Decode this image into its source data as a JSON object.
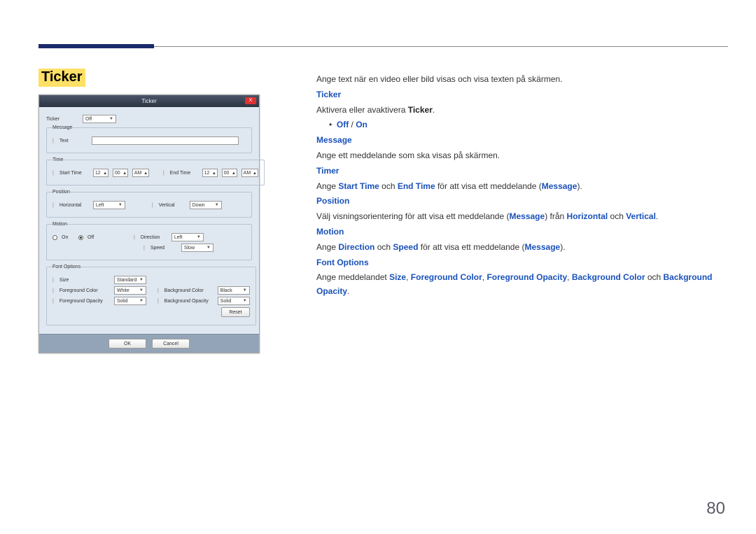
{
  "page_number": "80",
  "title": "Ticker",
  "dialog": {
    "title": "Ticker",
    "close": "X",
    "ticker_label": "Ticker",
    "ticker_value": "Off",
    "message_label": "Message",
    "text_label": "Text",
    "time_label": "Time",
    "start_time_label": "Start Time",
    "end_time_label": "End Time",
    "start_h": "12",
    "start_m": "00",
    "start_ampm": "AM",
    "end_h": "12",
    "end_m": "00",
    "end_ampm": "AM",
    "position_label": "Position",
    "horizontal_label": "Horizontal",
    "horizontal_value": "Left",
    "vertical_label": "Vertical",
    "vertical_value": "Down",
    "motion_label": "Motion",
    "motion_on_label": "On",
    "motion_off_label": "Off",
    "direction_label": "Direction",
    "direction_value": "Left",
    "speed_label": "Speed",
    "speed_value": "Slow",
    "font_options_label": "Font Options",
    "size_label": "Size",
    "size_value": "Standard",
    "fg_color_label": "Foreground Color",
    "fg_color_value": "White",
    "bg_color_label": "Background Color",
    "bg_color_value": "Black",
    "fg_opacity_label": "Foreground Opacity",
    "fg_opacity_value": "Solid",
    "bg_opacity_label": "Background Opacity",
    "bg_opacity_value": "Solid",
    "reset": "Reset",
    "ok": "OK",
    "cancel": "Cancel"
  },
  "desc": {
    "intro": "Ange text när en video eller bild visas och visa texten på skärmen.",
    "ticker_h": "Ticker",
    "ticker_p1": "Aktivera eller avaktivera ",
    "ticker_p1b": "Ticker",
    "ticker_p1c": ".",
    "off": "Off",
    "slash": " / ",
    "on": "On",
    "message_h": "Message",
    "message_p": "Ange ett meddelande som ska visas på skärmen.",
    "timer_h": "Timer",
    "timer_p1": "Ange ",
    "start_time": "Start Time",
    "timer_p2": " och ",
    "end_time": "End Time",
    "timer_p3": " för att visa ett meddelande (",
    "msg": "Message",
    "timer_p4": ").",
    "position_h": "Position",
    "pos_p1": "Välj visningsorientering för att visa ett meddelande (",
    "pos_p2": ") från ",
    "horizontal": "Horizontal",
    "pos_p3": " och ",
    "vertical": "Vertical",
    "pos_p4": ".",
    "motion_h": "Motion",
    "mot_p1": "Ange ",
    "direction": "Direction",
    "mot_p2": " och ",
    "speed": "Speed",
    "mot_p3": " för att visa ett meddelande (",
    "mot_p4": ").",
    "font_h": "Font Options",
    "fo_p1": "Ange meddelandet ",
    "size": "Size",
    "fo_c1": ", ",
    "fgc": "Foreground Color",
    "fo_c2": ", ",
    "fgo": "Foreground Opacity",
    "fo_c3": ", ",
    "bgc": "Background Color",
    "fo_p2": " och ",
    "bgo": "Background Opacity",
    "fo_p3": "."
  }
}
